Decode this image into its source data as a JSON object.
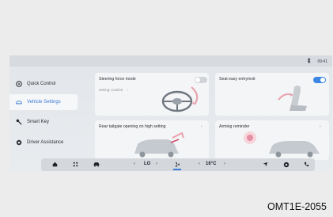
{
  "status_bar": {
    "bluetooth_icon": "bluetooth-icon",
    "time": "09:41"
  },
  "sidebar": {
    "items": [
      {
        "label": "Quick Control",
        "icon": "steering-wheel-icon",
        "active": false
      },
      {
        "label": "Vehicle Settings",
        "icon": "car-icon",
        "active": true
      },
      {
        "label": "Smart Key",
        "icon": "key-icon",
        "active": false
      },
      {
        "label": "Driver Assistance",
        "icon": "driver-assist-icon",
        "active": false
      }
    ]
  },
  "cards": {
    "steering_force": {
      "title": "Steering force mode",
      "setting": "Setting: Comfort",
      "chevron": "›",
      "enabled": false
    },
    "seat_easy": {
      "title": "Seat easy entry/exit",
      "enabled": true
    },
    "rear_tailgate": {
      "title": "Rear tailgate opening on high setting",
      "chevron": "›"
    },
    "arming_reminder": {
      "title": "Arming reminder",
      "chevron": "›"
    }
  },
  "dock": {
    "home_icon": "home-icon",
    "apps_icon": "apps-icon",
    "car_icon": "car-icon",
    "fan_level": "LO",
    "fan_icon": "fan-icon",
    "temperature": "16°C",
    "left_arrow": "‹",
    "right_arrow": "›",
    "nav_icon": "navigation-icon",
    "settings_icon": "settings-icon",
    "phone_icon": "phone-icon"
  },
  "caption": "OMT1E-2055",
  "colors": {
    "accent": "#3c7bd8",
    "toggle_on": "#3c87e6"
  }
}
